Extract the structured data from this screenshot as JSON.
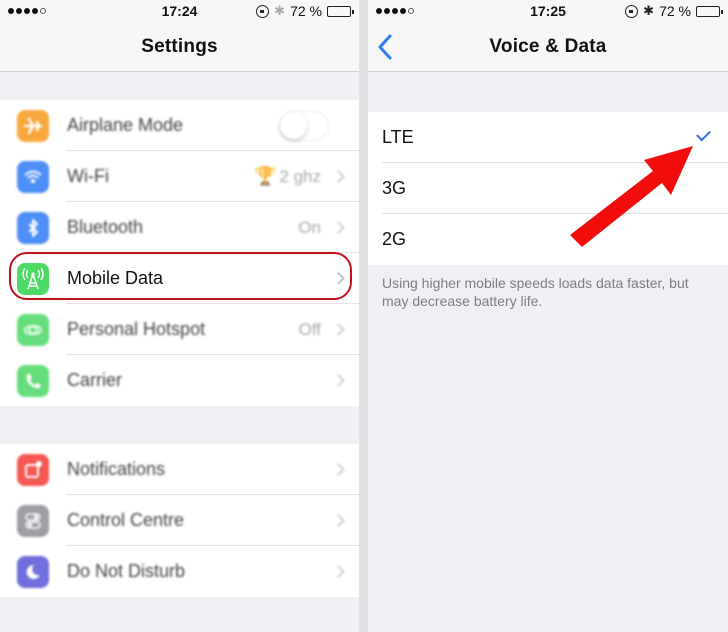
{
  "left_screen": {
    "status_bar": {
      "signal_dots_filled": 4,
      "signal_dots_total": 5,
      "time": "17:24",
      "battery_percent_text": "72 %",
      "battery_level": 0.72
    },
    "nav": {
      "title": "Settings"
    },
    "groups": [
      {
        "items": [
          {
            "label": "Airplane Mode",
            "icon": "airplane-icon",
            "icon_color": "#f89a1c",
            "control": "toggle",
            "toggle_on": false
          },
          {
            "label": "Wi-Fi",
            "icon": "wifi-icon",
            "icon_color": "#2f7cf6",
            "value": "2 ghz",
            "value_icon": "trophy-icon",
            "control": "chevron"
          },
          {
            "label": "Bluetooth",
            "icon": "bluetooth-icon",
            "icon_color": "#2f7cf6",
            "value": "On",
            "control": "chevron"
          },
          {
            "label": "Mobile Data",
            "icon": "antenna-icon",
            "icon_color": "#4cd964",
            "control": "chevron",
            "highlighted": true
          },
          {
            "label": "Personal Hotspot",
            "icon": "hotspot-icon",
            "icon_color": "#4cd964",
            "value": "Off",
            "control": "chevron"
          },
          {
            "label": "Carrier",
            "icon": "phone-icon",
            "icon_color": "#4cd964",
            "control": "chevron"
          }
        ]
      },
      {
        "items": [
          {
            "label": "Notifications",
            "icon": "notifications-icon",
            "icon_color": "#f33c33",
            "control": "chevron"
          },
          {
            "label": "Control Centre",
            "icon": "control-centre-icon",
            "icon_color": "#8e8e93",
            "control": "chevron"
          },
          {
            "label": "Do Not Disturb",
            "icon": "moon-icon",
            "icon_color": "#5856d6",
            "control": "chevron"
          }
        ]
      }
    ]
  },
  "right_screen": {
    "status_bar": {
      "signal_dots_filled": 4,
      "signal_dots_total": 5,
      "time": "17:25",
      "battery_percent_text": "72 %",
      "battery_level": 0.72
    },
    "nav": {
      "title": "Voice & Data",
      "back_icon": "chevron-left-icon"
    },
    "options": [
      {
        "label": "LTE",
        "selected": true
      },
      {
        "label": "3G",
        "selected": false
      },
      {
        "label": "2G",
        "selected": false
      }
    ],
    "footer": "Using higher mobile speeds loads data faster, but may decrease battery life."
  },
  "annotations": {
    "highlight_color": "#c0121a",
    "arrow_color": "#f20d0d",
    "arrow_target": "LTE checkmark"
  },
  "colors": {
    "ios_blue": "#2f6fdc",
    "group_background": "#efeff4"
  }
}
